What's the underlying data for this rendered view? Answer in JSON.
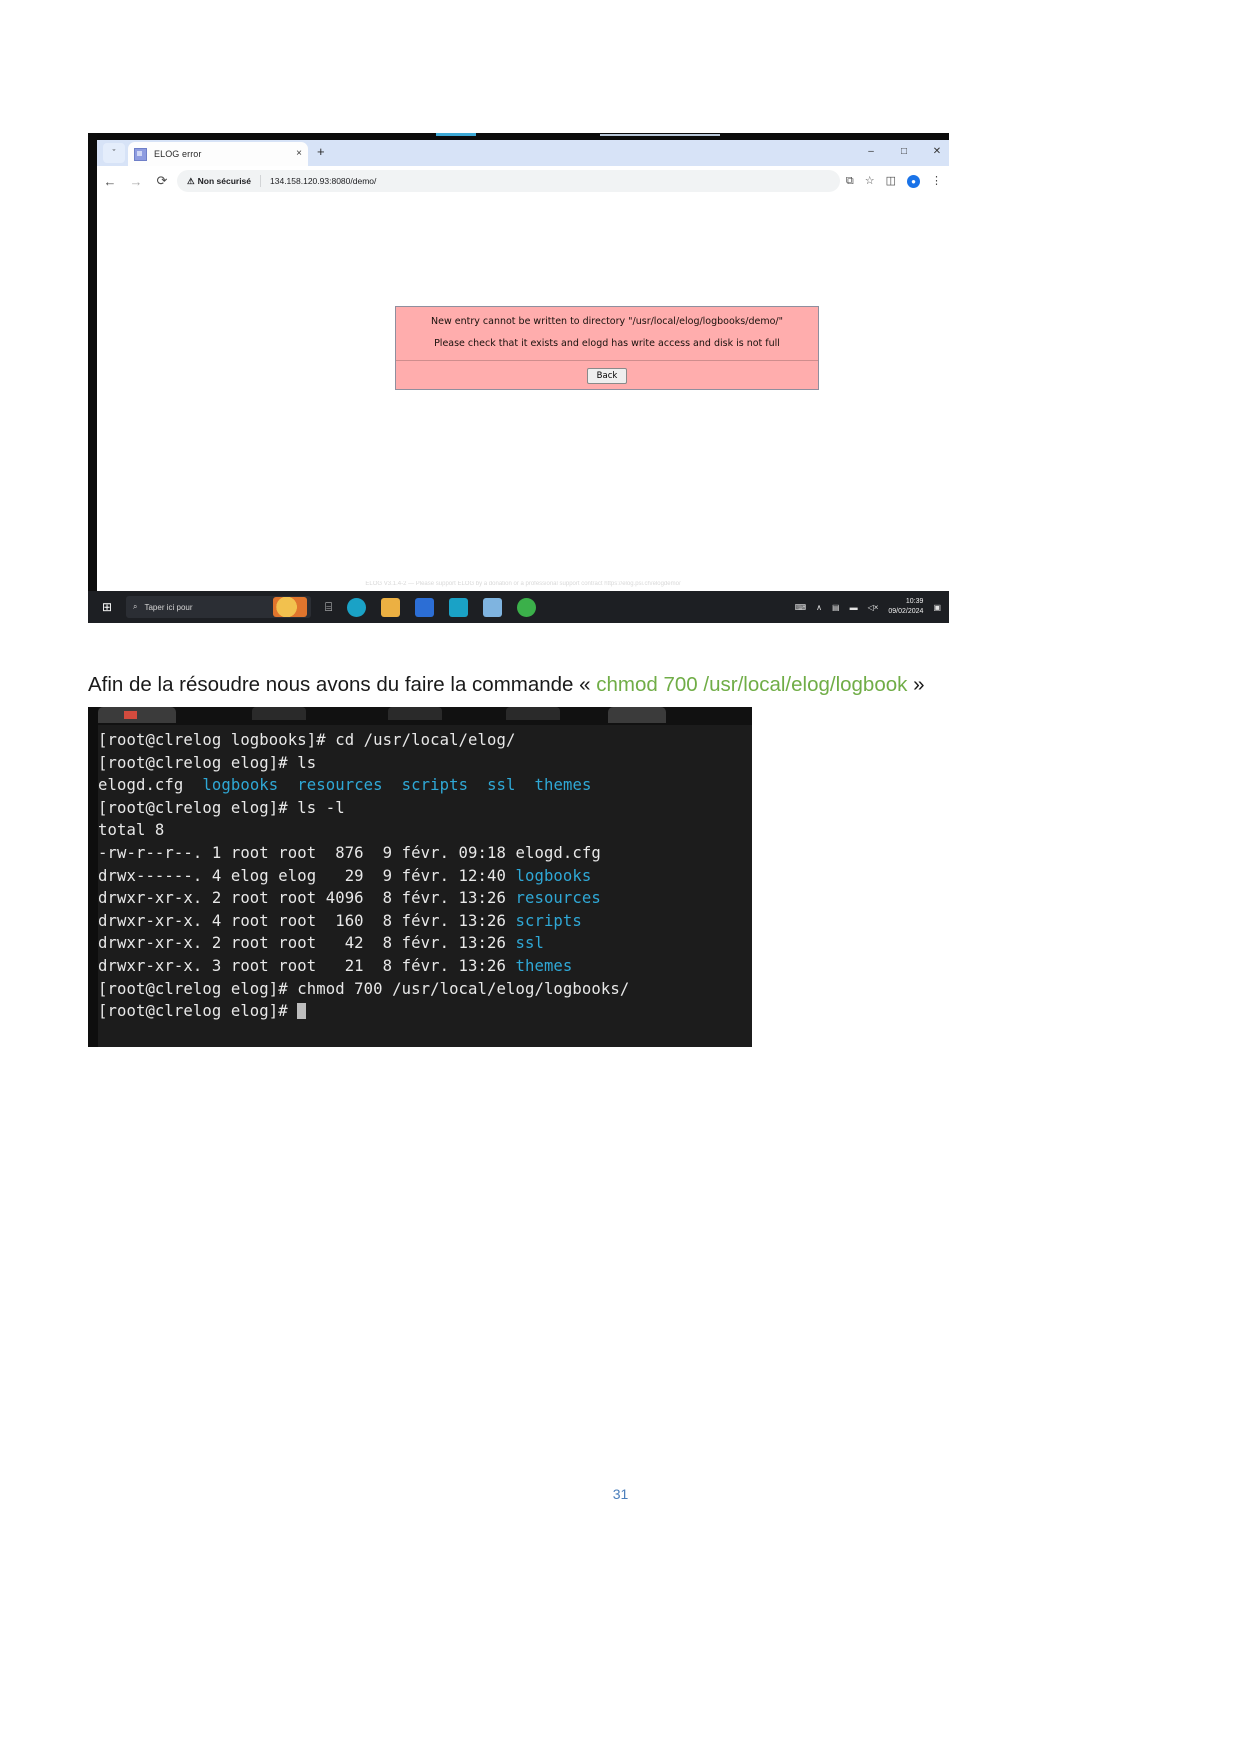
{
  "browser": {
    "tab": {
      "title": "ELOG error",
      "favicon_icon": "elog-favicon-icon",
      "close_icon": "×",
      "chevron_icon": "ˇ",
      "new_tab_icon": "+"
    },
    "window_controls": {
      "minimize": "–",
      "maximize": "□",
      "close": "✕"
    },
    "nav": {
      "back_icon": "←",
      "forward_icon": "→",
      "reload_icon": "⟳",
      "security_warning_icon": "⚠",
      "security_label": "Non sécurisé",
      "url": "134.158.120.93:8080/demo/",
      "translate_icon": "⧉",
      "bookmark_icon": "☆",
      "sidepanel_icon": "◫",
      "profile_icon": "●",
      "menu_icon": "⋮"
    },
    "alert": {
      "line1": "New entry cannot be written to directory \"/usr/local/elog/logbooks/demo/\"",
      "line2": "Please check that it exists and elogd has write access and disk is not full",
      "back_button": "Back",
      "bg_color": "#ffadad",
      "border_color": "#8f8f9e"
    },
    "page_footer_ghost": "ELOG V3.1.4-2 — Please support ELOG by a donation or a professional support contract  https://elog.psi.ch/elogdemo/",
    "taskbar": {
      "start_icon": "⊞",
      "search_icon": "⌕",
      "search_placeholder": "Taper ici pour",
      "taskview_icon": "⌸",
      "apps": [
        {
          "name": "edge-icon",
          "color": "#1aa2c6"
        },
        {
          "name": "file-explorer-icon",
          "color": "#ecb042"
        },
        {
          "name": "store-icon",
          "color": "#2c6ed5"
        },
        {
          "name": "mail-icon",
          "color": "#1aa2c6"
        },
        {
          "name": "photos-icon",
          "color": "#7fb4e0"
        },
        {
          "name": "chrome-icon",
          "color": "#3bb04a"
        }
      ],
      "tray": {
        "keyboard_icon": "⌨",
        "chevron_icon": "∧",
        "network_icon": "▤",
        "battery_icon": "▬",
        "volume_icon": "◁×",
        "notification_icon": "▣",
        "time": "10:39",
        "date": "09/02/2024"
      }
    }
  },
  "paragraph": {
    "lead": "Afin de la résoudre nous avons du faire la commande « ",
    "command_part1": "chmod 700",
    "command_part2": "/usr/local/elog/logbook",
    "tail": " »",
    "command_color": "#70ad47"
  },
  "terminal": {
    "lines": [
      {
        "segments": [
          {
            "t": "[root@clrelog logbooks]# cd /usr/local/elog/",
            "c": "normal"
          }
        ]
      },
      {
        "segments": [
          {
            "t": "[root@clrelog elog]# ls",
            "c": "normal"
          }
        ]
      },
      {
        "segments": [
          {
            "t": "elogd.cfg  ",
            "c": "normal"
          },
          {
            "t": "logbooks",
            "c": "dir"
          },
          {
            "t": "  ",
            "c": "normal"
          },
          {
            "t": "resources",
            "c": "dir"
          },
          {
            "t": "  ",
            "c": "normal"
          },
          {
            "t": "scripts",
            "c": "dir"
          },
          {
            "t": "  ",
            "c": "normal"
          },
          {
            "t": "ssl",
            "c": "dir"
          },
          {
            "t": "  ",
            "c": "normal"
          },
          {
            "t": "themes",
            "c": "dir"
          }
        ]
      },
      {
        "segments": [
          {
            "t": "[root@clrelog elog]# ls -l",
            "c": "normal"
          }
        ]
      },
      {
        "segments": [
          {
            "t": "total 8",
            "c": "normal"
          }
        ]
      },
      {
        "segments": [
          {
            "t": "-rw-r--r--. 1 root root  876  9 févr. 09:18 elogd.cfg",
            "c": "normal"
          }
        ]
      },
      {
        "segments": [
          {
            "t": "drwx------. 4 elog elog   29  9 févr. 12:40 ",
            "c": "normal"
          },
          {
            "t": "logbooks",
            "c": "dir"
          }
        ]
      },
      {
        "segments": [
          {
            "t": "drwxr-xr-x. 2 root root 4096  8 févr. 13:26 ",
            "c": "normal"
          },
          {
            "t": "resources",
            "c": "dir"
          }
        ]
      },
      {
        "segments": [
          {
            "t": "drwxr-xr-x. 4 root root  160  8 févr. 13:26 ",
            "c": "normal"
          },
          {
            "t": "scripts",
            "c": "dir"
          }
        ]
      },
      {
        "segments": [
          {
            "t": "drwxr-xr-x. 2 root root   42  8 févr. 13:26 ",
            "c": "normal"
          },
          {
            "t": "ssl",
            "c": "dir"
          }
        ]
      },
      {
        "segments": [
          {
            "t": "drwxr-xr-x. 3 root root   21  8 févr. 13:26 ",
            "c": "normal"
          },
          {
            "t": "themes",
            "c": "dir"
          }
        ]
      },
      {
        "segments": [
          {
            "t": "[root@clrelog elog]# chmod 700 /usr/local/elog/logbooks/",
            "c": "normal"
          }
        ]
      },
      {
        "segments": [
          {
            "t": "[root@clrelog elog]# ",
            "c": "normal"
          },
          {
            "t": "",
            "c": "cursor"
          }
        ]
      }
    ],
    "dir_color": "#2fa8d6",
    "text_color": "#e8e8e8",
    "bg_color": "#1c1c1c"
  },
  "footer": {
    "page_number": "31"
  }
}
